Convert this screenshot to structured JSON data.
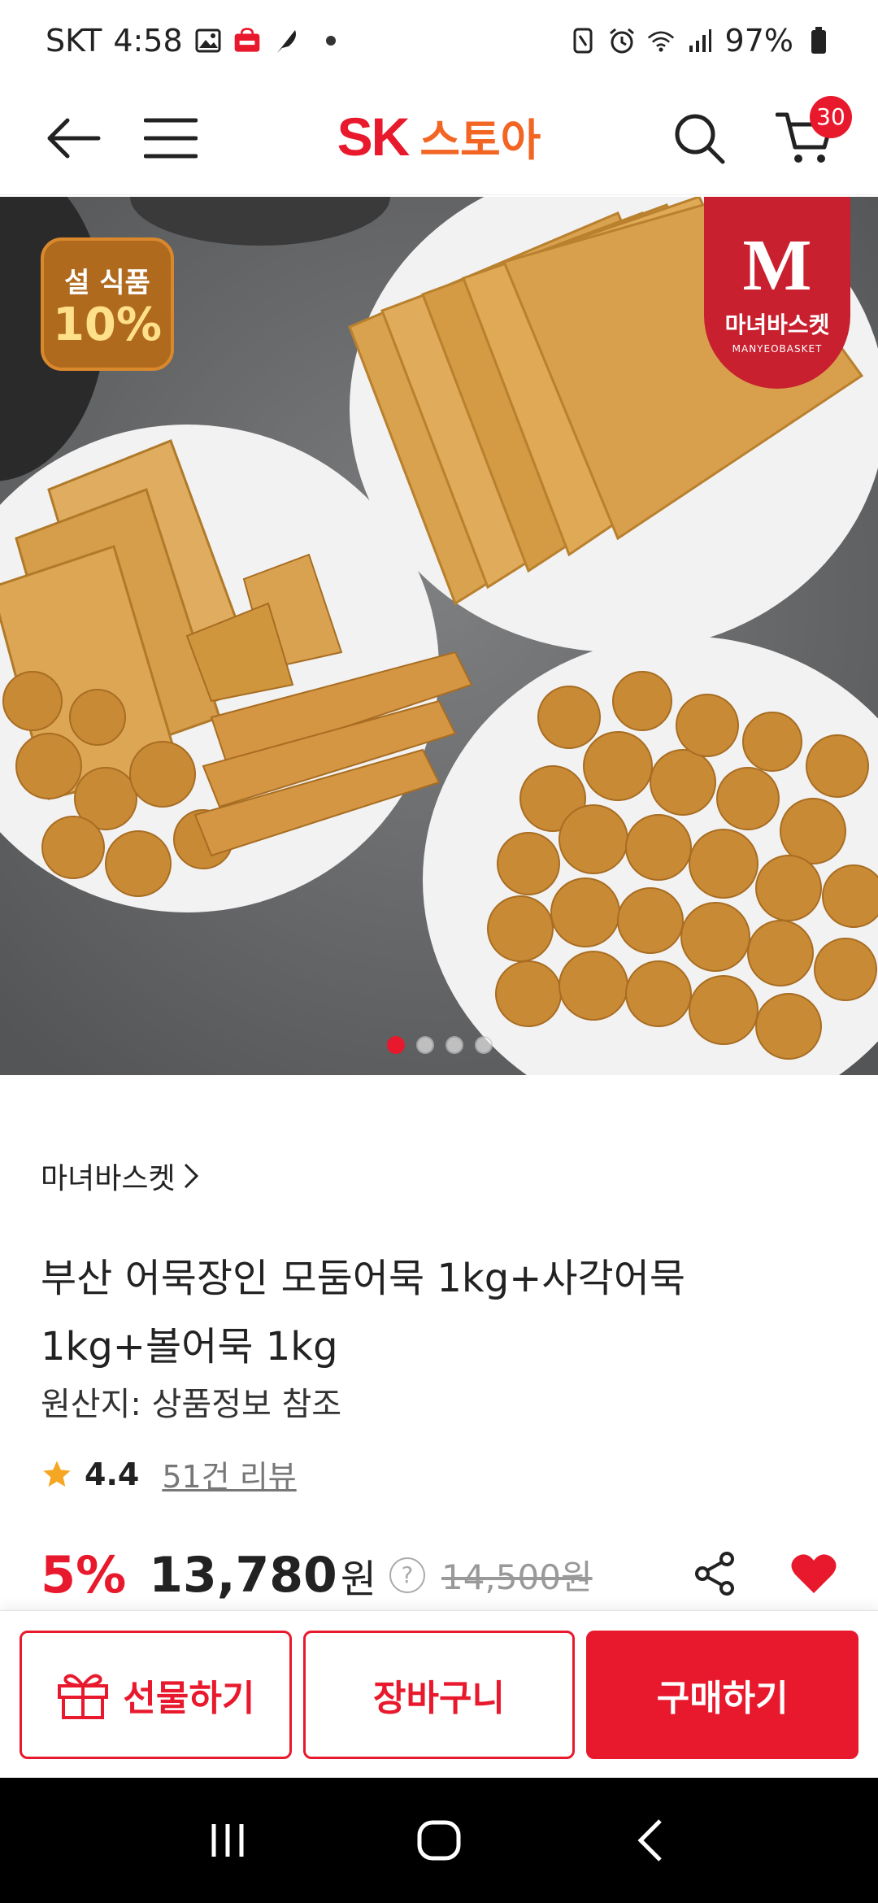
{
  "status_bar": {
    "carrier": "SKT",
    "time": "4:58",
    "notification_icons": [
      "gallery-icon",
      "sk-store-icon",
      "feather-icon"
    ],
    "system_icons": [
      "nfc-icon",
      "alarm-icon",
      "wifi-icon",
      "signal-icon"
    ],
    "battery": "97%"
  },
  "header": {
    "logo_sk": "SK",
    "logo_store": "스토아",
    "cart_count": "30"
  },
  "gallery": {
    "sale_badge_line1": "설 식품",
    "sale_badge_line2": "10%",
    "brand_mark": "M",
    "brand_name": "마녀바스켓",
    "brand_sub": "MANYEOBASKET",
    "slide_count": 4,
    "active_slide": 1
  },
  "product": {
    "brand": "마녀바스켓",
    "title": "부산 어묵장인 모둠어묵 1kg+사각어묵 1kg+볼어묵 1kg",
    "origin": "원산지: 상품정보 참조",
    "rating": "4.4",
    "reviews": "51건 리뷰",
    "discount": "5%",
    "price": "13,780",
    "currency": "원",
    "help": "?",
    "original_price": "14,500원"
  },
  "actions": {
    "gift": "선물하기",
    "cart": "장바구니",
    "buy": "구매하기"
  },
  "colors": {
    "brand_red": "#e8192c",
    "brand_orange": "#f26522"
  }
}
